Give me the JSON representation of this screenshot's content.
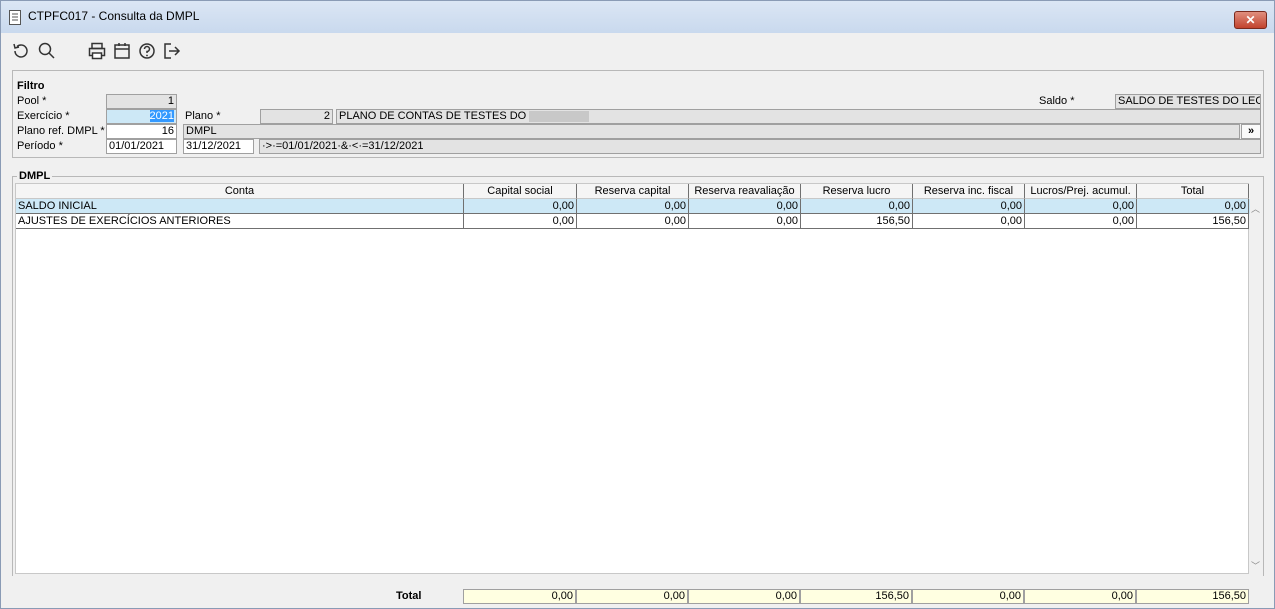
{
  "window": {
    "title": "CTPFC017 - Consulta da DMPL",
    "close_label": "✕"
  },
  "toolbar": {
    "icons": [
      "refresh-icon",
      "search-icon",
      "print-icon",
      "calendar-icon",
      "help-icon",
      "exit-icon"
    ]
  },
  "filter": {
    "title": "Filtro",
    "pool_label": "Pool *",
    "pool_value": "1",
    "exercicio_label": "Exercício *",
    "exercicio_value": "2021",
    "plano_label": "Plano *",
    "plano_value": "2",
    "plano_desc": "PLANO DE CONTAS DE TESTES DO",
    "plano_ref_label": "Plano ref. DMPL *",
    "plano_ref_value": "16",
    "plano_ref_desc": "DMPL",
    "periodo_label": "Período *",
    "periodo_start": "01/01/2021",
    "periodo_end": "31/12/2021",
    "periodo_expr": "·>·=01/01/2021·&·<·=31/12/2021",
    "saldo_label": "Saldo *",
    "saldo_value": "SALDO DE TESTES DO LEON",
    "expand_button": "»"
  },
  "dmpl": {
    "title": "DMPL",
    "columns": [
      "Conta",
      "Capital social",
      "Reserva capital",
      "Reserva reavaliação",
      "Reserva lucro",
      "Reserva inc. fiscal",
      "Lucros/Prej. acumul.",
      "Total"
    ],
    "rows": [
      {
        "conta": "SALDO INICIAL",
        "values": [
          "0,00",
          "0,00",
          "0,00",
          "0,00",
          "0,00",
          "0,00",
          "0,00"
        ]
      },
      {
        "conta": "AJUSTES DE EXERCÍCIOS ANTERIORES",
        "values": [
          "0,00",
          "0,00",
          "0,00",
          "156,50",
          "0,00",
          "0,00",
          "156,50"
        ]
      }
    ],
    "totals_label": "Total",
    "totals": [
      "0,00",
      "0,00",
      "0,00",
      "156,50",
      "0,00",
      "0,00",
      "156,50"
    ]
  },
  "colors": {
    "selected_row": "#cde8f6",
    "selection_highlight": "#3399ff",
    "totals_bg": "#ffffe1",
    "close_button": "#c2432e"
  }
}
